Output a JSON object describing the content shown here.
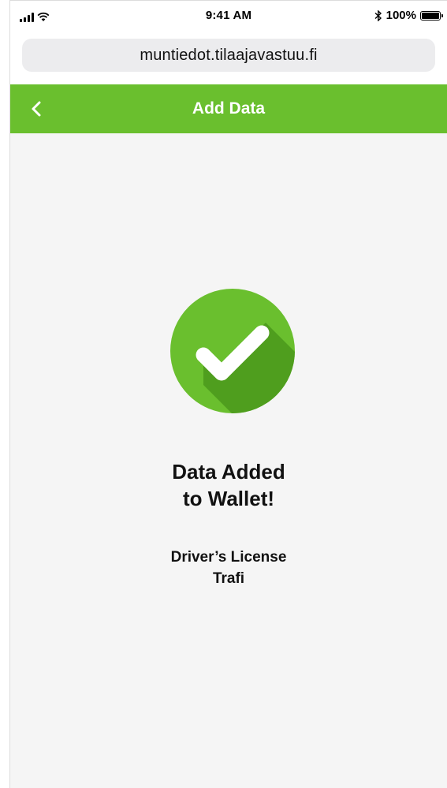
{
  "status_bar": {
    "time": "9:41 AM",
    "battery_text": "100%",
    "icons": [
      "signal-icon",
      "wifi-icon",
      "bluetooth-icon",
      "battery-icon"
    ]
  },
  "browser": {
    "url": "muntiedot.tilaajavastuu.fi"
  },
  "header": {
    "title": "Add Data",
    "back_icon": "chevron-left-icon"
  },
  "main": {
    "success_icon": "checkmark-circle-icon",
    "title_line1": "Data Added",
    "title_line2": "to Wallet!",
    "item_name": "Driver’s License",
    "item_issuer": "Trafi"
  },
  "colors": {
    "accent": "#6abf2e",
    "check_circle": "#6abf2e",
    "check_shadow": "#4f9e1e",
    "background": "#f5f5f5"
  }
}
